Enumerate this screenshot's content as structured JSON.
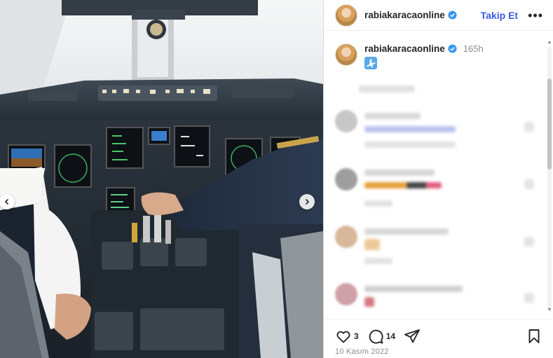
{
  "header": {
    "username": "rabiakaracaonline",
    "follow_label": "Takip Et",
    "more_label": "•••"
  },
  "caption": {
    "username": "rabiakaracaonline",
    "time_ago": "165h",
    "emoji_icon": "airplane-icon"
  },
  "comments": {
    "blurred": true,
    "count_visible": 4
  },
  "actions": {
    "like_count": "3",
    "comment_count": "14"
  },
  "post_date": "10 Kasım 2022",
  "colors": {
    "follow_blue": "#3b5bdb",
    "verified_blue": "#3897f0",
    "text": "#262626",
    "muted": "#8e8e8e"
  }
}
